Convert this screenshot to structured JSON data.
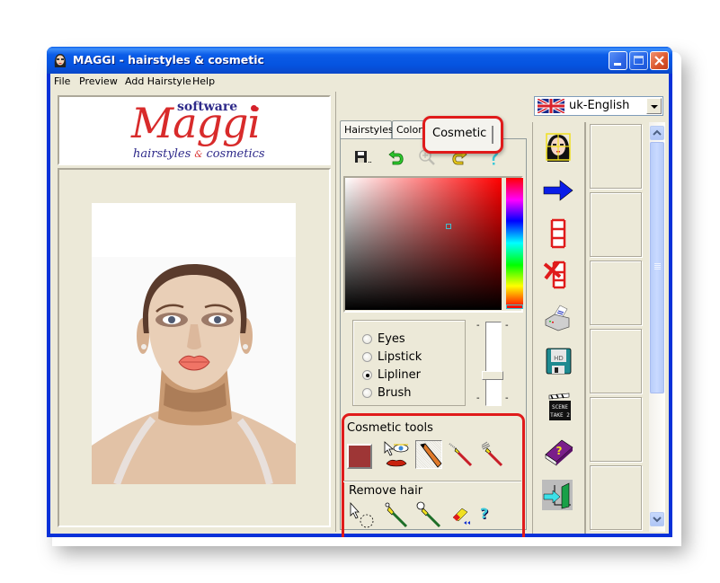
{
  "window": {
    "title": "MAGGI - hairstyles & cosmetic",
    "controls": {
      "minimize": "minimize",
      "maximize": "maximize",
      "close": "close"
    }
  },
  "menu": [
    {
      "label": "File"
    },
    {
      "label": "Preview"
    },
    {
      "label": "Add Hairstyle"
    },
    {
      "label": "Help"
    }
  ],
  "logo": {
    "software": "software",
    "brand": "Maggi",
    "subtitle_left": "hairstyles",
    "subtitle_amp": "&",
    "subtitle_right": "cosmetics"
  },
  "tabs": {
    "items": [
      {
        "label": "Hairstyles"
      },
      {
        "label": "Colors"
      },
      {
        "label": "Cosmetic"
      }
    ],
    "active": "Cosmetic"
  },
  "toolbar": {
    "icons": [
      "save-icon",
      "undo-icon",
      "zoom-icon",
      "redo-icon",
      "help-icon"
    ]
  },
  "color_picker": {
    "base_hue": "#ff0000",
    "marker_color": "#3fbfcf"
  },
  "cosmetic_mode": {
    "options": [
      {
        "label": "Eyes",
        "checked": false
      },
      {
        "label": "Lipstick",
        "checked": false
      },
      {
        "label": "Lipliner",
        "checked": true
      },
      {
        "label": "Brush",
        "checked": false
      }
    ],
    "intensity_fraction": 0.65,
    "slider_tick": "-"
  },
  "cosmetic_tools": {
    "label": "Cosmetic tools",
    "current_color": "#9e3636",
    "tools": [
      "color-swatch",
      "eye-lip-select-tool",
      "pencil-tool",
      "brush-tool",
      "fan-brush-tool"
    ],
    "pressed": "pencil-tool"
  },
  "remove_hair": {
    "label": "Remove hair",
    "tools": [
      "lasso-select-tool",
      "small-brush-tool",
      "large-brush-tool",
      "eraser-tool",
      "help-tool"
    ],
    "help_glyph": "?"
  },
  "language": {
    "selected": "uk-English"
  },
  "side_toolbar": {
    "buttons": [
      "face-grid-icon",
      "next-arrow-icon",
      "add-frame-icon",
      "delete-frame-icon",
      "print-icon",
      "save-disk-icon",
      "scene-clapper-icon",
      "help-book-icon",
      "exit-door-icon"
    ],
    "clapper_text_1": "SCENE",
    "clapper_text_2": "TAKE 2",
    "disk_label": "HD"
  },
  "accent": {
    "highlight_red": "#e01b1b",
    "xp_blue": "#0553df"
  }
}
